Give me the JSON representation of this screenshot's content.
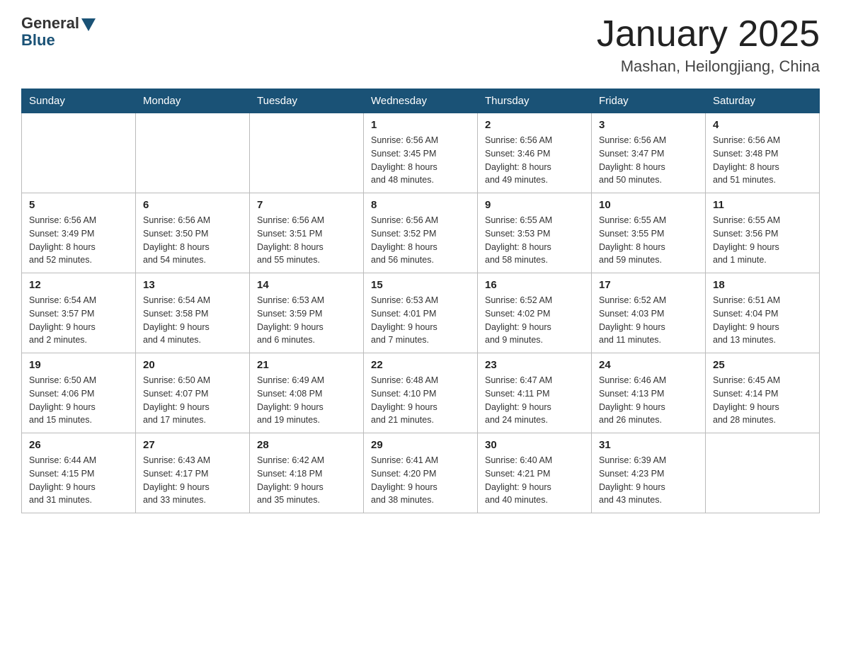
{
  "header": {
    "logo_general": "General",
    "logo_blue": "Blue",
    "month_title": "January 2025",
    "location": "Mashan, Heilongjiang, China"
  },
  "weekdays": [
    "Sunday",
    "Monday",
    "Tuesday",
    "Wednesday",
    "Thursday",
    "Friday",
    "Saturday"
  ],
  "weeks": [
    [
      {
        "day": "",
        "info": ""
      },
      {
        "day": "",
        "info": ""
      },
      {
        "day": "",
        "info": ""
      },
      {
        "day": "1",
        "info": "Sunrise: 6:56 AM\nSunset: 3:45 PM\nDaylight: 8 hours\nand 48 minutes."
      },
      {
        "day": "2",
        "info": "Sunrise: 6:56 AM\nSunset: 3:46 PM\nDaylight: 8 hours\nand 49 minutes."
      },
      {
        "day": "3",
        "info": "Sunrise: 6:56 AM\nSunset: 3:47 PM\nDaylight: 8 hours\nand 50 minutes."
      },
      {
        "day": "4",
        "info": "Sunrise: 6:56 AM\nSunset: 3:48 PM\nDaylight: 8 hours\nand 51 minutes."
      }
    ],
    [
      {
        "day": "5",
        "info": "Sunrise: 6:56 AM\nSunset: 3:49 PM\nDaylight: 8 hours\nand 52 minutes."
      },
      {
        "day": "6",
        "info": "Sunrise: 6:56 AM\nSunset: 3:50 PM\nDaylight: 8 hours\nand 54 minutes."
      },
      {
        "day": "7",
        "info": "Sunrise: 6:56 AM\nSunset: 3:51 PM\nDaylight: 8 hours\nand 55 minutes."
      },
      {
        "day": "8",
        "info": "Sunrise: 6:56 AM\nSunset: 3:52 PM\nDaylight: 8 hours\nand 56 minutes."
      },
      {
        "day": "9",
        "info": "Sunrise: 6:55 AM\nSunset: 3:53 PM\nDaylight: 8 hours\nand 58 minutes."
      },
      {
        "day": "10",
        "info": "Sunrise: 6:55 AM\nSunset: 3:55 PM\nDaylight: 8 hours\nand 59 minutes."
      },
      {
        "day": "11",
        "info": "Sunrise: 6:55 AM\nSunset: 3:56 PM\nDaylight: 9 hours\nand 1 minute."
      }
    ],
    [
      {
        "day": "12",
        "info": "Sunrise: 6:54 AM\nSunset: 3:57 PM\nDaylight: 9 hours\nand 2 minutes."
      },
      {
        "day": "13",
        "info": "Sunrise: 6:54 AM\nSunset: 3:58 PM\nDaylight: 9 hours\nand 4 minutes."
      },
      {
        "day": "14",
        "info": "Sunrise: 6:53 AM\nSunset: 3:59 PM\nDaylight: 9 hours\nand 6 minutes."
      },
      {
        "day": "15",
        "info": "Sunrise: 6:53 AM\nSunset: 4:01 PM\nDaylight: 9 hours\nand 7 minutes."
      },
      {
        "day": "16",
        "info": "Sunrise: 6:52 AM\nSunset: 4:02 PM\nDaylight: 9 hours\nand 9 minutes."
      },
      {
        "day": "17",
        "info": "Sunrise: 6:52 AM\nSunset: 4:03 PM\nDaylight: 9 hours\nand 11 minutes."
      },
      {
        "day": "18",
        "info": "Sunrise: 6:51 AM\nSunset: 4:04 PM\nDaylight: 9 hours\nand 13 minutes."
      }
    ],
    [
      {
        "day": "19",
        "info": "Sunrise: 6:50 AM\nSunset: 4:06 PM\nDaylight: 9 hours\nand 15 minutes."
      },
      {
        "day": "20",
        "info": "Sunrise: 6:50 AM\nSunset: 4:07 PM\nDaylight: 9 hours\nand 17 minutes."
      },
      {
        "day": "21",
        "info": "Sunrise: 6:49 AM\nSunset: 4:08 PM\nDaylight: 9 hours\nand 19 minutes."
      },
      {
        "day": "22",
        "info": "Sunrise: 6:48 AM\nSunset: 4:10 PM\nDaylight: 9 hours\nand 21 minutes."
      },
      {
        "day": "23",
        "info": "Sunrise: 6:47 AM\nSunset: 4:11 PM\nDaylight: 9 hours\nand 24 minutes."
      },
      {
        "day": "24",
        "info": "Sunrise: 6:46 AM\nSunset: 4:13 PM\nDaylight: 9 hours\nand 26 minutes."
      },
      {
        "day": "25",
        "info": "Sunrise: 6:45 AM\nSunset: 4:14 PM\nDaylight: 9 hours\nand 28 minutes."
      }
    ],
    [
      {
        "day": "26",
        "info": "Sunrise: 6:44 AM\nSunset: 4:15 PM\nDaylight: 9 hours\nand 31 minutes."
      },
      {
        "day": "27",
        "info": "Sunrise: 6:43 AM\nSunset: 4:17 PM\nDaylight: 9 hours\nand 33 minutes."
      },
      {
        "day": "28",
        "info": "Sunrise: 6:42 AM\nSunset: 4:18 PM\nDaylight: 9 hours\nand 35 minutes."
      },
      {
        "day": "29",
        "info": "Sunrise: 6:41 AM\nSunset: 4:20 PM\nDaylight: 9 hours\nand 38 minutes."
      },
      {
        "day": "30",
        "info": "Sunrise: 6:40 AM\nSunset: 4:21 PM\nDaylight: 9 hours\nand 40 minutes."
      },
      {
        "day": "31",
        "info": "Sunrise: 6:39 AM\nSunset: 4:23 PM\nDaylight: 9 hours\nand 43 minutes."
      },
      {
        "day": "",
        "info": ""
      }
    ]
  ]
}
